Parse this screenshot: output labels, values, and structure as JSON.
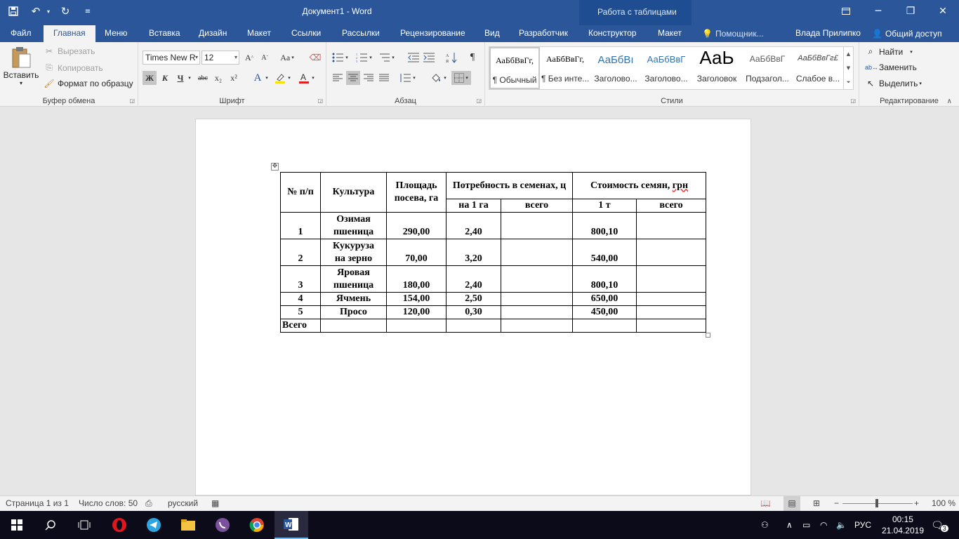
{
  "titlebar": {
    "doc_title": "Документ1 - Word",
    "context_title": "Работа с таблицами"
  },
  "tabs": {
    "file": "Файл",
    "home": "Главная",
    "menu": "Меню",
    "insert": "Вставка",
    "design": "Дизайн",
    "layout": "Макет",
    "references": "Ссылки",
    "mailings": "Рассылки",
    "review": "Рецензирование",
    "view": "Вид",
    "developer": "Разработчик",
    "constructor": "Конструктор",
    "table_layout": "Макет",
    "tell_me": "Помощник...",
    "user": "Влада Прилипко",
    "share": "Общий доступ"
  },
  "clipboard": {
    "paste": "Вставить",
    "cut": "Вырезать",
    "copy": "Копировать",
    "format_painter": "Формат по образцу",
    "label": "Буфер обмена"
  },
  "font": {
    "name": "Times New R",
    "size": "12",
    "bold": "Ж",
    "italic": "К",
    "underline": "Ч",
    "strike": "abc",
    "sub": "x₂",
    "sup": "x²",
    "grow": "A",
    "shrink": "A",
    "case": "Aa",
    "label": "Шрифт"
  },
  "paragraph": {
    "label": "Абзац"
  },
  "styles": {
    "items": [
      {
        "sample": "АаБбВвГг,",
        "name": "¶ Обычный"
      },
      {
        "sample": "АаБбВвГг,",
        "name": "¶ Без инте..."
      },
      {
        "sample": "АаБбВı",
        "name": "Заголово..."
      },
      {
        "sample": "АаБбВвГ",
        "name": "Заголово..."
      },
      {
        "sample": "АаЬ",
        "name": "Заголовок"
      },
      {
        "sample": "АаБбВвГ",
        "name": "Подзагол..."
      },
      {
        "sample": "АаБбВвГг£",
        "name": "Слабое в..."
      }
    ],
    "label": "Стили"
  },
  "editing": {
    "find": "Найти",
    "replace": "Заменить",
    "select": "Выделить",
    "label": "Редактирование"
  },
  "table": {
    "header": {
      "num": "№ п/п",
      "crop": "Культура",
      "area": "Площадь посева, га",
      "need": "Потребность в семенах, ц",
      "cost_prefix": "Стоимость семян, ",
      "cost_unit": "грн",
      "per_ha": "на 1 га",
      "need_total": "всего",
      "per_t": "1 т",
      "cost_total": "всего"
    },
    "rows": [
      {
        "num": "1",
        "crop_l1": "Озимая",
        "crop_l2": "пшеница",
        "area": "290,00",
        "per_ha": "2,40",
        "need_total": "",
        "per_t": "800,10",
        "cost_total": ""
      },
      {
        "num": "2",
        "crop_l1": "Кукуруза",
        "crop_l2": "на зерно",
        "area": "70,00",
        "per_ha": "3,20",
        "need_total": "",
        "per_t": "540,00",
        "cost_total": ""
      },
      {
        "num": "3",
        "crop_l1": "Яровая",
        "crop_l2": "пшеница",
        "area": "180,00",
        "per_ha": "2,40",
        "need_total": "",
        "per_t": "800,10",
        "cost_total": ""
      },
      {
        "num": "4",
        "crop": "Ячмень",
        "area": "154,00",
        "per_ha": "2,50",
        "need_total": "",
        "per_t": "650,00",
        "cost_total": ""
      },
      {
        "num": "5",
        "crop": "Просо",
        "area": "120,00",
        "per_ha": "0,30",
        "need_total": "",
        "per_t": "450,00",
        "cost_total": ""
      }
    ],
    "total_label": "Всего"
  },
  "statusbar": {
    "page": "Страница 1 из 1",
    "words": "Число слов: 50",
    "language": "русский",
    "zoom": "100 %"
  },
  "taskbar": {
    "lang": "РУС",
    "time": "00:15",
    "date": "21.04.2019",
    "notifications": "3"
  },
  "colors": {
    "word_blue": "#2b579a",
    "ribbon_bg": "#f3f3f3",
    "taskbar_bg": "#0b0b1a"
  }
}
